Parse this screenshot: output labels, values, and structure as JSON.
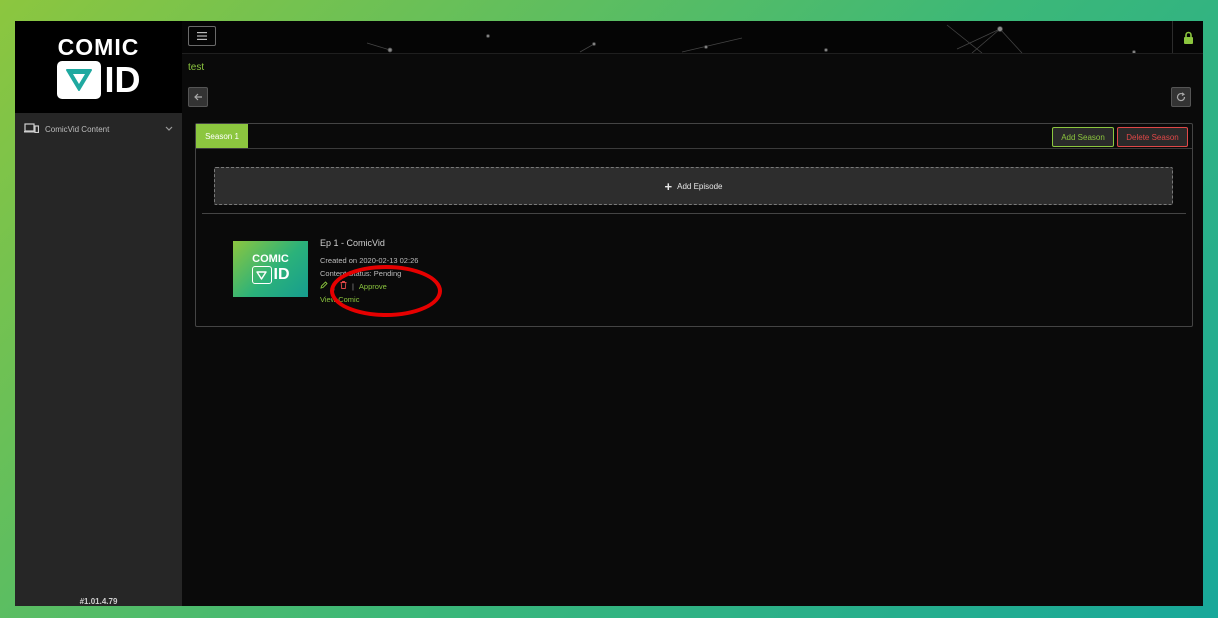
{
  "brand": {
    "logo_line1": "COMIC",
    "logo_line2": "ID",
    "version": "#1.01.4.79"
  },
  "sidebar": {
    "items": [
      {
        "label": "ComicVid Content",
        "icon": "devices-icon"
      }
    ]
  },
  "page": {
    "title": "test"
  },
  "season": {
    "tab_label": "Season 1",
    "add_season_label": "Add Season",
    "delete_season_label": "Delete Season",
    "add_episode_label": "Add Episode"
  },
  "episode": {
    "title": "Ep 1 - ComicVid",
    "created": "Created on 2020-02-13 02:26",
    "status": "Content Status: Pending",
    "approve_label": "Approve",
    "view_label": "View Comic",
    "thumb_line1": "COMIC",
    "thumb_line2": "ID"
  },
  "colors": {
    "accent": "#8cc63f",
    "danger": "#e04848",
    "highlight": "#e60000"
  }
}
